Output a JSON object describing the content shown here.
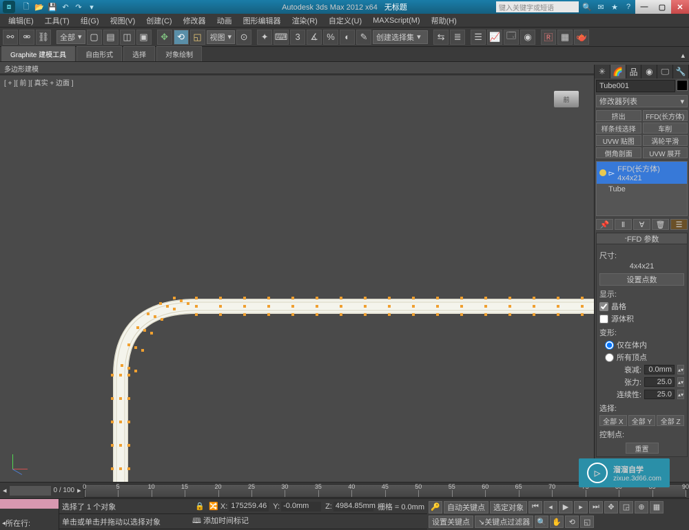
{
  "title": {
    "app": "Autodesk 3ds Max  2012 x64",
    "doc": "无标题"
  },
  "search_placeholder": "键入关键字或短语",
  "menu": [
    "编辑(E)",
    "工具(T)",
    "组(G)",
    "视图(V)",
    "创建(C)",
    "修改器",
    "动画",
    "图形编辑器",
    "渲染(R)",
    "自定义(U)",
    "MAXScript(M)",
    "帮助(H)"
  ],
  "toolbar_filter": "全部",
  "toolbar_view": "视图",
  "toolbar_selset": "创建选择集",
  "ribbon": {
    "tabs": [
      "Graphite 建模工具",
      "自由形式",
      "选择",
      "对象绘制"
    ],
    "sub": "多边形建模"
  },
  "viewport_label": "[ + ][ 前 ][ 真实 + 边面 ]",
  "viewcube": "前",
  "cmd": {
    "name": "Tube001",
    "modlist": "修改器列表",
    "buttons": [
      "挤出",
      "FFD(长方体)",
      "样条线选择",
      "车削",
      "UVW 贴图",
      "涡轮平滑",
      "倒角剖面",
      "UVW 展开"
    ],
    "stack": [
      {
        "label": "FFD(长方体) 4x4x21",
        "active": true,
        "bulb": true
      },
      {
        "label": "Tube",
        "active": false,
        "bulb": false
      }
    ],
    "rollout_title": "FFD 参数",
    "size_label": "尺寸:",
    "size_value": "4x4x21",
    "set_points": "设置点数",
    "disp_label": "显示:",
    "disp_lattice": "晶格",
    "disp_source": "源体积",
    "deform_label": "变形:",
    "deform_in": "仅在体内",
    "deform_all": "所有顶点",
    "falloff_label": "衰减:",
    "falloff_val": "0.0mm",
    "tension_label": "张力:",
    "tension_val": "25.0",
    "cont_label": "连续性:",
    "cont_val": "25.0",
    "sel_label": "选择:",
    "sel_btns": [
      "全部 X",
      "全部 Y",
      "全部 Z"
    ],
    "cp_label": "控制点:",
    "cp_reset": "重置"
  },
  "timeline": {
    "range": "0 / 100",
    "ticks": [
      0,
      5,
      10,
      15,
      20,
      25,
      30,
      35,
      40,
      45,
      50,
      55,
      60,
      65,
      70,
      75,
      80,
      85,
      90
    ]
  },
  "status": {
    "track_label": "所在行:",
    "sel_msg": "选择了 1 个对象",
    "prompt": "单击或单击并拖动以选择对象",
    "add_time": "添加时间标记",
    "x": "175259.46",
    "y": "-0.0mm",
    "z": "4984.85mm",
    "grid": "栅格 = 0.0mm",
    "autokey": "自动关键点",
    "selset2": "选定对象",
    "setkey": "设置关键点",
    "filter": "关键点过滤器"
  },
  "watermark": {
    "text": "溜溜自学",
    "url": "zixue.3d66.com"
  }
}
